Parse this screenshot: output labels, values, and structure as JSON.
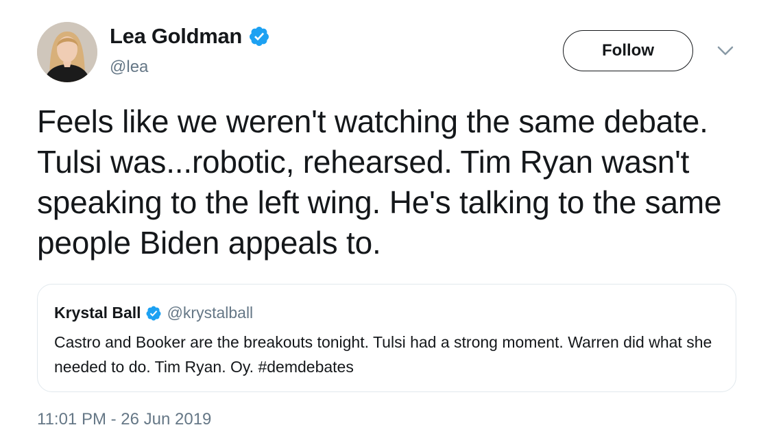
{
  "author": {
    "display_name": "Lea Goldman",
    "handle": "@lea",
    "verified": true,
    "avatar_icon": "avatar-photo"
  },
  "actions": {
    "follow_label": "Follow",
    "more_icon": "chevron-down-icon"
  },
  "tweet": {
    "text": "Feels like we weren't watching the same debate. Tulsi was...robotic, rehearsed. Tim Ryan wasn't speaking to the left wing. He's talking to the same people Biden appeals to.",
    "timestamp": "11:01 PM - 26 Jun 2019"
  },
  "quoted_tweet": {
    "display_name": "Krystal Ball",
    "handle": "@krystalball",
    "verified": true,
    "text": "Castro and Booker are the breakouts tonight. Tulsi had a strong moment. Warren did what she needed to do. Tim Ryan. Oy. #demdebates"
  },
  "colors": {
    "verified_blue": "#1da1f2",
    "secondary_text": "#657786",
    "border": "#e1e8ed",
    "primary_text": "#14171a"
  }
}
